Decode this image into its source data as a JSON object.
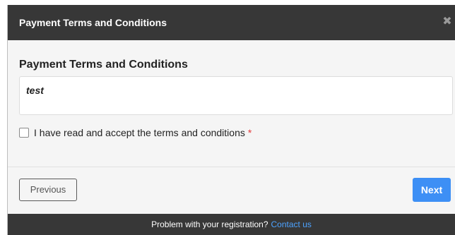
{
  "modal": {
    "header_title": "Payment Terms and Conditions",
    "close_icon": "close-icon"
  },
  "terms": {
    "section_title": "Payment Terms and Conditions",
    "content": "test"
  },
  "accept": {
    "label": "I have read and accept the terms and conditions",
    "required_mark": "*",
    "checked": false
  },
  "buttons": {
    "previous": "Previous",
    "next": "Next"
  },
  "footer": {
    "text": "Problem with your registration?",
    "link": "Contact us"
  },
  "colors": {
    "header_bg": "#373737",
    "footer_bg": "#373737",
    "primary": "#3d8ff5",
    "link": "#4da3ff",
    "required": "#e23b3b"
  }
}
